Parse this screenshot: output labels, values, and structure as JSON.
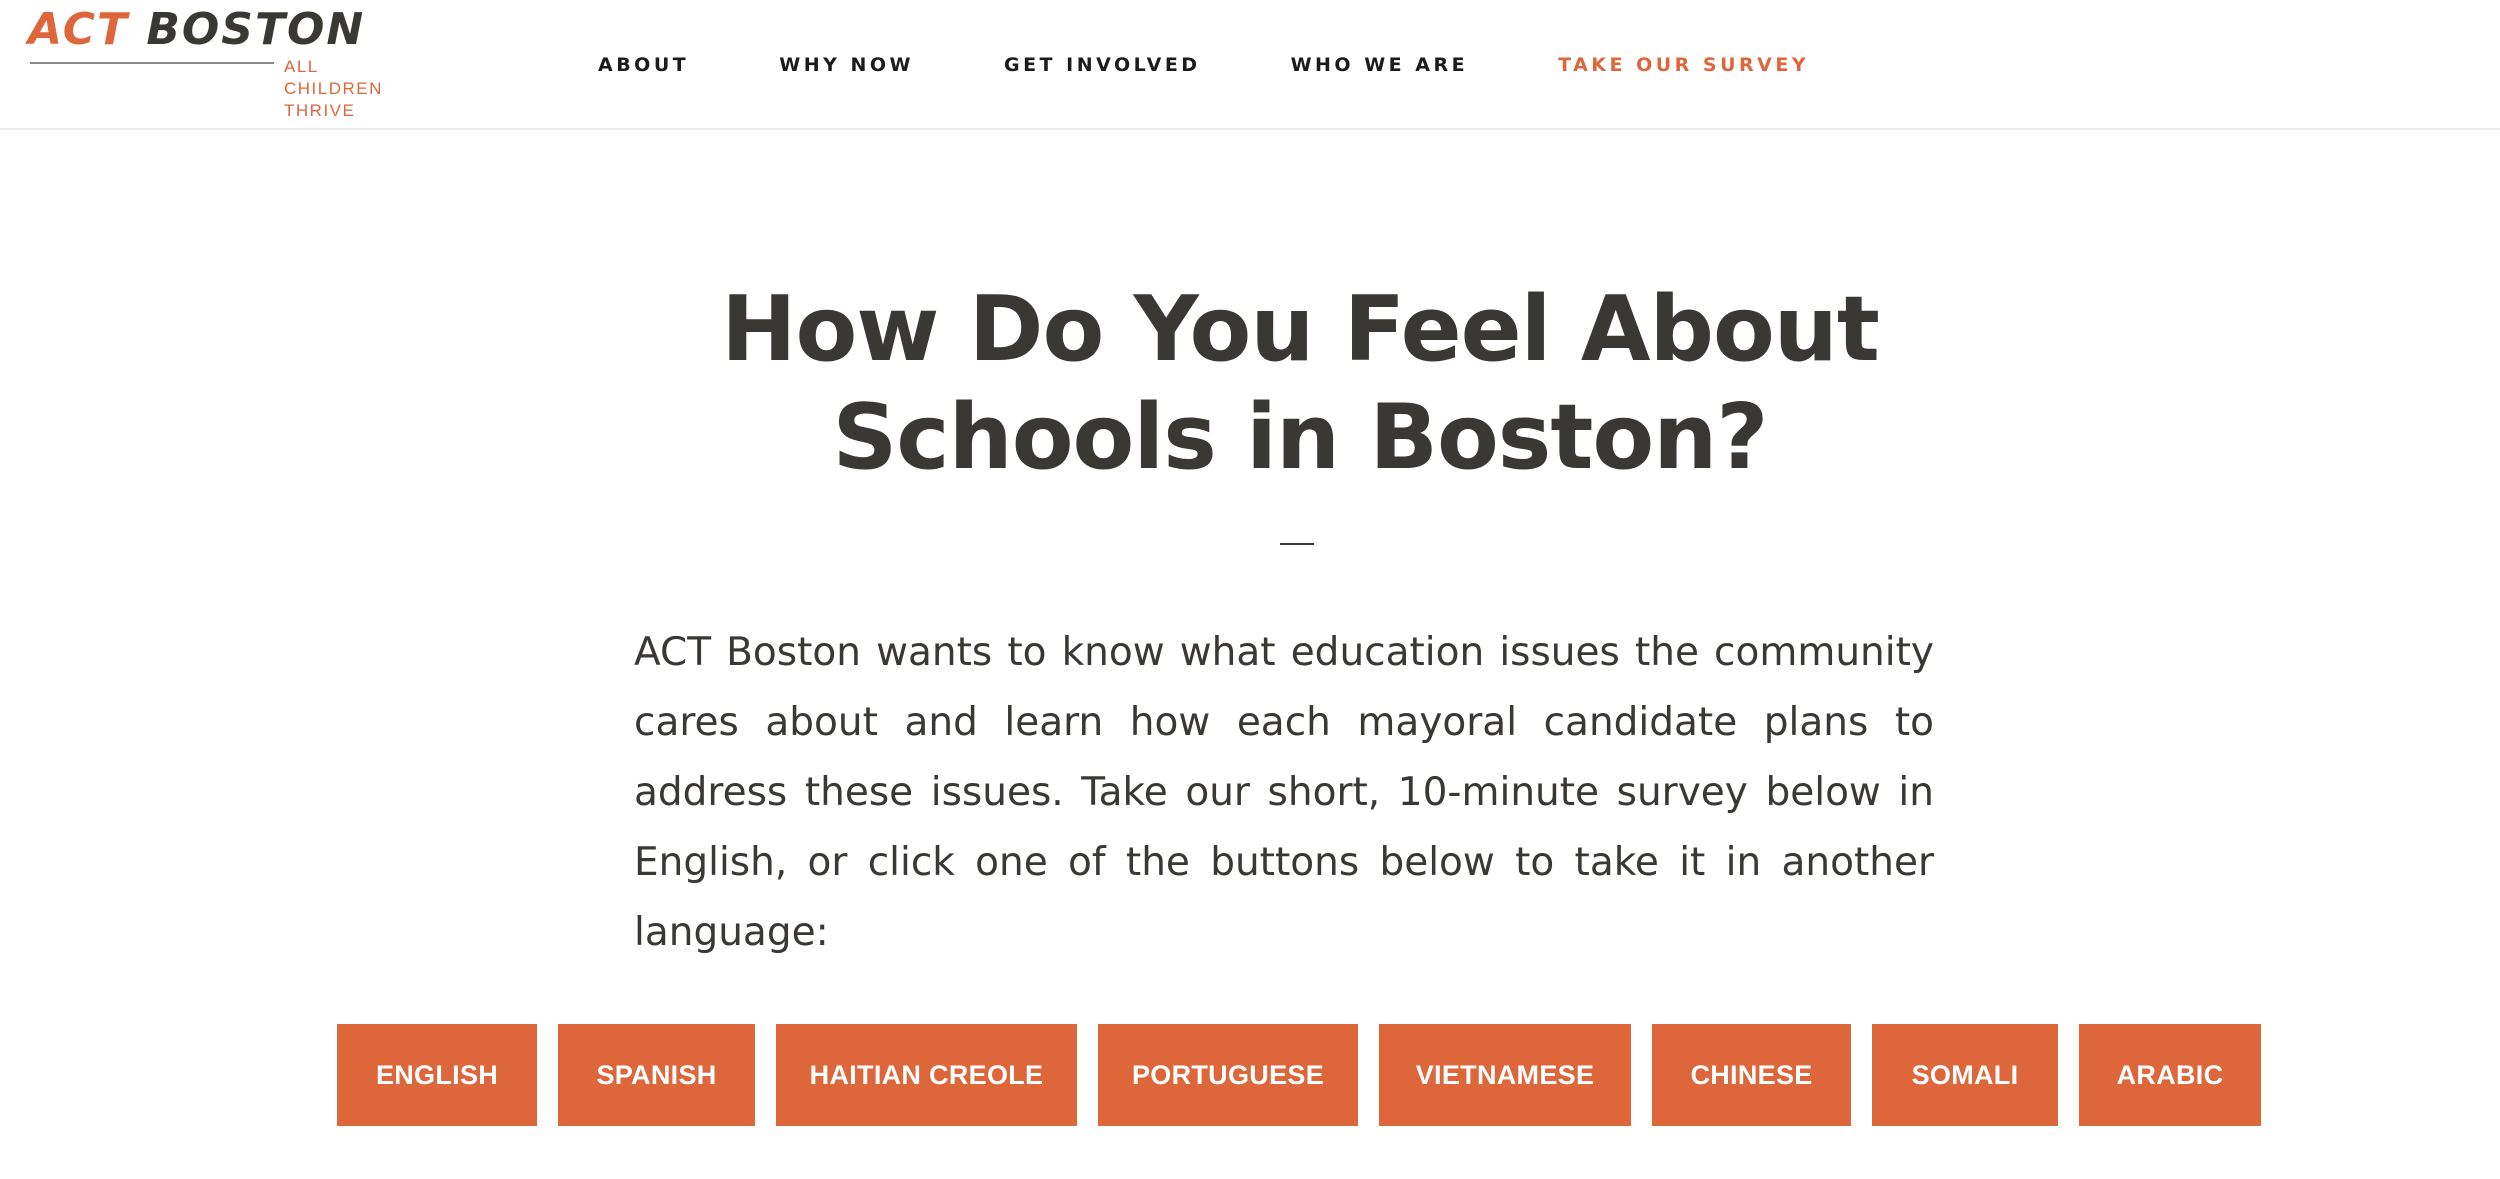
{
  "brand": {
    "name_part1": "ACT",
    "name_part2": "BOSTON",
    "tagline": [
      "ALL",
      "CHILDREN",
      "THRIVE"
    ],
    "accent_color": "#dd663a",
    "text_color": "#3a3834"
  },
  "nav": {
    "items": [
      {
        "label": "ABOUT"
      },
      {
        "label": "WHY NOW"
      },
      {
        "label": "GET INVOLVED"
      },
      {
        "label": "WHO WE ARE"
      },
      {
        "label": "TAKE OUR SURVEY",
        "highlight": true
      }
    ]
  },
  "hero": {
    "title_line1": "How Do You Feel About",
    "title_line2": "Schools in Boston?",
    "dash": "—",
    "intro": "ACT Boston wants to know what education issues the community cares about and learn how each mayoral candidate plans to address these issues. Take our short, 10-minute survey below in English, or click one of the buttons below to take it in another language:"
  },
  "languages": {
    "buttons": [
      {
        "label": "ENGLISH"
      },
      {
        "label": "SPANISH"
      },
      {
        "label": "HAITIAN CREOLE"
      },
      {
        "label": "PORTUGUESE"
      },
      {
        "label": "VIETNAMESE"
      },
      {
        "label": "CHINESE"
      },
      {
        "label": "SOMALI"
      },
      {
        "label": "ARABIC"
      }
    ]
  }
}
